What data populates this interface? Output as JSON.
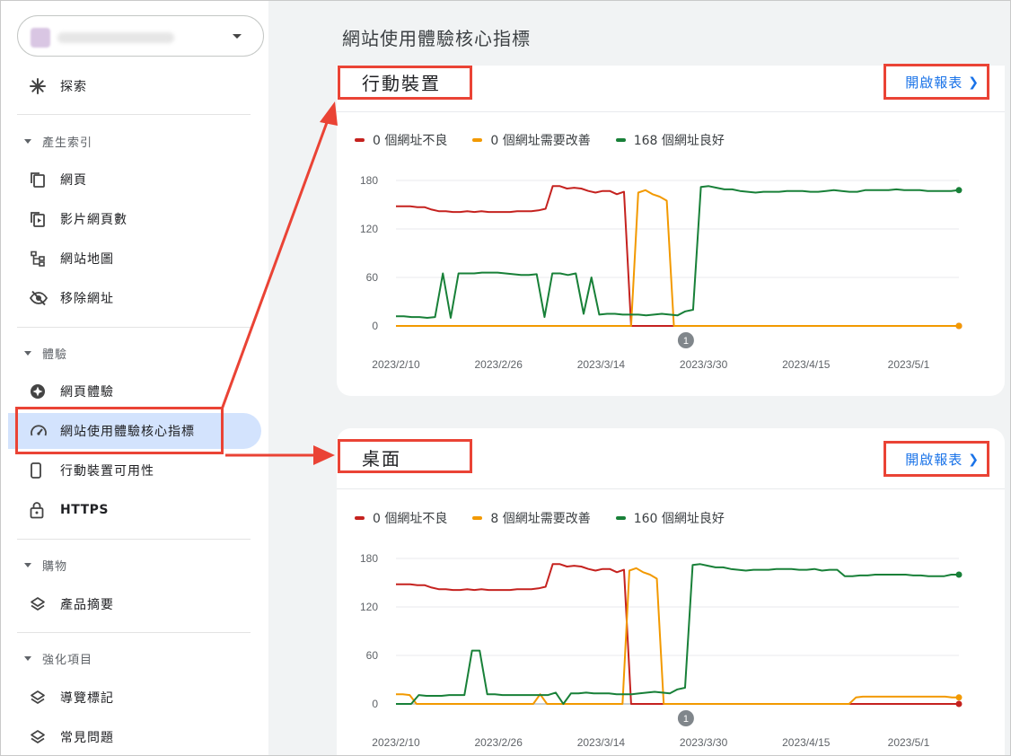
{
  "page": {
    "title": "網站使用體驗核心指標"
  },
  "sidebar": {
    "explore": "探索",
    "sections": [
      {
        "label": "產生索引",
        "items": [
          "網頁",
          "影片網頁數",
          "網站地圖",
          "移除網址"
        ]
      },
      {
        "label": "體驗",
        "items": [
          "網頁體驗",
          "網站使用體驗核心指標",
          "行動裝置可用性",
          "HTTPS"
        ]
      },
      {
        "label": "購物",
        "items": [
          "產品摘要"
        ]
      },
      {
        "label": "強化項目",
        "items": [
          "導覽標記",
          "常見問題"
        ]
      }
    ],
    "active": "網站使用體驗核心指標"
  },
  "cards": [
    {
      "title": "行動裝置",
      "link": "開啟報表",
      "legend": [
        "0 個網址不良",
        "0 個網址需要改善",
        "168 個網址良好"
      ],
      "chart_data": {
        "type": "line",
        "x": [
          "2023/2/10",
          "2023/2/26",
          "2023/3/14",
          "2023/3/30",
          "2023/4/15",
          "2023/5/1"
        ],
        "y_ticks": [
          0,
          60,
          120,
          180
        ],
        "ylim": [
          0,
          180
        ],
        "annotation": "1",
        "series": [
          {
            "name": "0 個網址不良",
            "color": "#c5221f",
            "values": [
              148,
              148,
              148,
              147,
              147,
              144,
              142,
              142,
              141,
              141,
              142,
              141,
              142,
              141,
              141,
              141,
              141,
              142,
              142,
              142,
              143,
              145,
              173,
              173,
              170,
              171,
              170,
              167,
              165,
              167,
              167,
              163,
              166,
              0,
              0,
              0,
              0,
              0,
              0,
              0,
              0,
              0,
              0,
              0,
              0,
              0,
              0,
              0,
              0,
              0,
              0,
              0,
              0,
              0,
              0,
              0,
              0,
              0,
              0,
              0,
              0,
              0,
              0,
              0,
              0,
              0,
              0,
              0,
              0,
              0,
              0,
              0,
              0,
              0,
              0,
              0,
              0,
              0,
              0,
              0
            ]
          },
          {
            "name": "0 個網址需要改善",
            "color": "#f29900",
            "values": [
              0,
              0,
              0,
              0,
              0,
              0,
              0,
              0,
              0,
              0,
              0,
              0,
              0,
              0,
              0,
              0,
              0,
              0,
              0,
              0,
              0,
              0,
              0,
              0,
              0,
              0,
              0,
              0,
              0,
              0,
              0,
              0,
              0,
              0,
              165,
              168,
              163,
              160,
              155,
              0,
              0,
              0,
              0,
              0,
              0,
              0,
              0,
              0,
              0,
              0,
              0,
              0,
              0,
              0,
              0,
              0,
              0,
              0,
              0,
              0,
              0,
              0,
              0,
              0,
              0,
              0,
              0,
              0,
              0,
              0,
              0,
              0,
              0,
              0,
              0,
              0,
              0,
              0,
              0,
              0
            ]
          },
          {
            "name": "168 個網址良好",
            "color": "#188038",
            "values": [
              12,
              12,
              11,
              11,
              10,
              11,
              65,
              10,
              65,
              65,
              65,
              66,
              66,
              66,
              65,
              64,
              63,
              63,
              64,
              11,
              65,
              65,
              63,
              65,
              15,
              60,
              14,
              15,
              15,
              14,
              14,
              14,
              13,
              14,
              15,
              14,
              13,
              18,
              20,
              172,
              173,
              171,
              169,
              169,
              167,
              166,
              165,
              166,
              166,
              166,
              167,
              167,
              167,
              166,
              166,
              167,
              168,
              167,
              166,
              166,
              168,
              168,
              168,
              168,
              169,
              168,
              168,
              168,
              167,
              167,
              167,
              167,
              168
            ]
          }
        ]
      }
    },
    {
      "title": "桌面",
      "link": "開啟報表",
      "legend": [
        "0 個網址不良",
        "8 個網址需要改善",
        "160 個網址良好"
      ],
      "chart_data": {
        "type": "line",
        "x": [
          "2023/2/10",
          "2023/2/26",
          "2023/3/14",
          "2023/3/30",
          "2023/4/15",
          "2023/5/1"
        ],
        "y_ticks": [
          0,
          60,
          120,
          180
        ],
        "ylim": [
          0,
          180
        ],
        "annotation": "1",
        "series": [
          {
            "name": "0 個網址不良",
            "color": "#c5221f",
            "values": [
              148,
              148,
              148,
              147,
              147,
              144,
              142,
              142,
              141,
              141,
              142,
              141,
              142,
              141,
              141,
              141,
              141,
              142,
              142,
              142,
              143,
              145,
              173,
              173,
              170,
              171,
              170,
              167,
              165,
              167,
              167,
              163,
              166,
              0,
              0,
              0,
              0,
              0,
              0,
              0,
              0,
              0,
              0,
              0,
              0,
              0,
              0,
              0,
              0,
              0,
              0,
              0,
              0,
              0,
              0,
              0,
              0,
              0,
              0,
              0,
              0,
              0,
              0,
              0,
              0,
              0,
              0,
              0,
              0,
              0,
              0,
              0,
              0,
              0,
              0,
              0,
              0,
              0,
              0,
              0
            ]
          },
          {
            "name": "8 個網址需要改善",
            "color": "#f29900",
            "values": [
              12,
              12,
              11,
              0,
              0,
              0,
              0,
              0,
              0,
              0,
              0,
              0,
              0,
              0,
              0,
              0,
              0,
              0,
              0,
              0,
              0,
              12,
              0,
              0,
              0,
              0,
              0,
              0,
              0,
              0,
              0,
              0,
              0,
              0,
              165,
              168,
              163,
              160,
              155,
              0,
              0,
              0,
              0,
              0,
              0,
              0,
              0,
              0,
              0,
              0,
              0,
              0,
              0,
              0,
              0,
              0,
              0,
              0,
              0,
              0,
              0,
              0,
              0,
              0,
              0,
              0,
              0,
              8,
              9,
              9,
              9,
              9,
              9,
              9,
              9,
              9,
              9,
              9,
              9,
              9,
              9,
              8,
              8
            ]
          },
          {
            "name": "160 個網址良好",
            "color": "#188038",
            "values": [
              0,
              0,
              0,
              11,
              10,
              10,
              10,
              11,
              11,
              11,
              66,
              66,
              12,
              12,
              11,
              11,
              11,
              11,
              11,
              11,
              11,
              14,
              0,
              13,
              13,
              14,
              13,
              13,
              13,
              12,
              12,
              12,
              13,
              14,
              15,
              14,
              13,
              18,
              20,
              172,
              173,
              171,
              169,
              169,
              167,
              166,
              165,
              166,
              166,
              166,
              167,
              167,
              167,
              166,
              166,
              167,
              165,
              166,
              166,
              158,
              158,
              159,
              159,
              160,
              160,
              160,
              160,
              160,
              159,
              159,
              158,
              158,
              158,
              160,
              160
            ]
          }
        ]
      }
    }
  ],
  "colors": {
    "annotation_red": "#ea4335",
    "link_blue": "#1a73e8",
    "active_bg": "#d3e3fd"
  }
}
